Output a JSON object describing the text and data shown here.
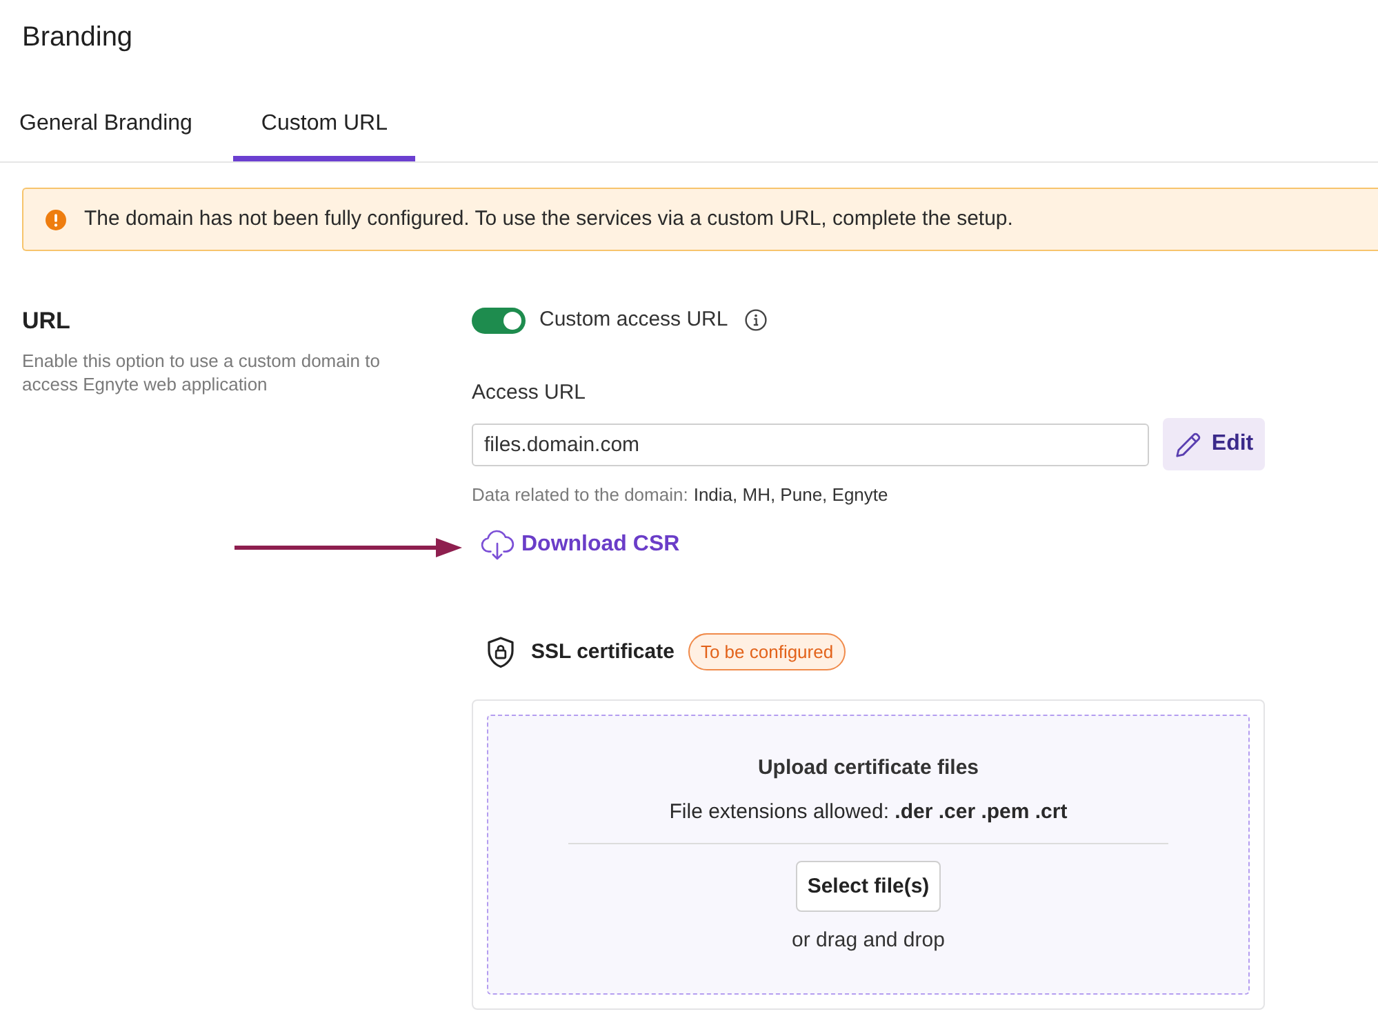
{
  "page": {
    "title": "Branding"
  },
  "tabs": [
    {
      "label": "General Branding",
      "selected": false
    },
    {
      "label": "Custom URL",
      "selected": true
    }
  ],
  "alert": {
    "kind": "warning",
    "message": "The domain has not been fully configured. To use the services via a custom URL, complete the setup."
  },
  "url_section": {
    "heading": "URL",
    "description": "Enable this option to use a custom domain to access Egnyte web application",
    "toggle": {
      "label": "Custom access URL",
      "on": true
    },
    "access_url": {
      "label": "Access URL",
      "value": "files.domain.com",
      "edit_button": "Edit",
      "helper_label": "Data related to the domain:",
      "helper_value": "India, MH, Pune, Egnyte"
    },
    "download_link": "Download CSR",
    "ssl": {
      "title": "SSL certificate",
      "status": "To be configured"
    },
    "upload": {
      "title": "Upload certificate files",
      "extensions": "File extensions allowed: **.der .cer .pem .crt**",
      "button": "Select file(s)",
      "hint": "or drag and drop"
    }
  }
}
